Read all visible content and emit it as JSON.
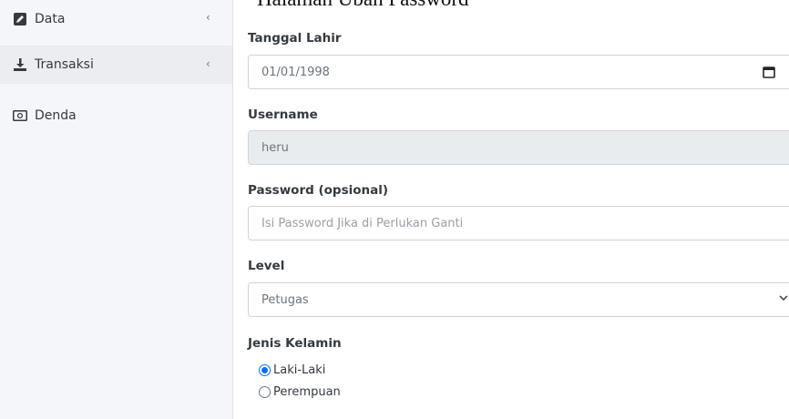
{
  "page": {
    "title": "Halaman Ubah Password"
  },
  "sidebar": {
    "items": [
      {
        "label": "Data",
        "icon": "edit-square-icon",
        "chevron": "‹"
      },
      {
        "label": "Transaksi",
        "icon": "download-icon",
        "chevron": "‹"
      },
      {
        "label": "Denda",
        "icon": "money-bill-icon"
      }
    ]
  },
  "form": {
    "tanggal_lahir": {
      "label": "Tanggal Lahir",
      "value": "01/01/1998"
    },
    "username": {
      "label": "Username",
      "value": "heru"
    },
    "password": {
      "label": "Password (opsional)",
      "placeholder": "Isi Password Jika di Perlukan Ganti"
    },
    "level": {
      "label": "Level",
      "selected": "Petugas"
    },
    "jenis_kelamin": {
      "label": "Jenis Kelamin",
      "options": [
        {
          "label": "Laki-Laki",
          "checked": true
        },
        {
          "label": "Perempuan",
          "checked": false
        }
      ]
    }
  },
  "colors": {
    "accent": "#0d6efd",
    "sidebar_bg": "#f4f6f9",
    "readonly_bg": "#e9ecef"
  }
}
